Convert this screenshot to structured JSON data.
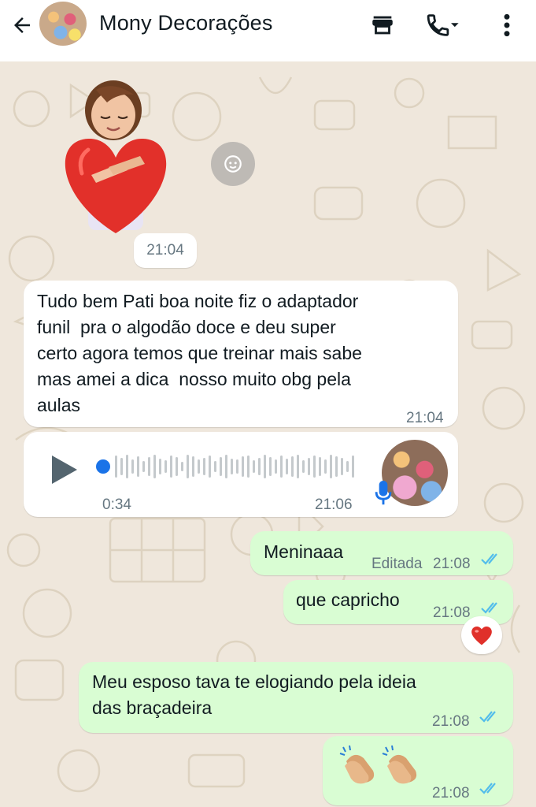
{
  "header": {
    "contact_name": "Mony Decorações",
    "icons": [
      "back-arrow-icon",
      "store-icon",
      "phone-call-icon",
      "more-vert-icon"
    ]
  },
  "messages": [
    {
      "type": "sticker",
      "direction": "incoming",
      "time": "21:04"
    },
    {
      "type": "text",
      "direction": "incoming",
      "lines": [
        "Tudo bem Pati boa noite fiz o adaptador",
        "funil  pra o algodão doce e deu super",
        "certo agora temos que treinar mais sabe",
        "mas amei a dica  nosso muito obg pela",
        "aulas"
      ],
      "time": "21:04"
    },
    {
      "type": "audio",
      "direction": "incoming",
      "duration": "0:34",
      "time": "21:06",
      "progress": 0.0
    },
    {
      "type": "text",
      "direction": "outgoing",
      "text": "Meninaaa",
      "edited_label": "Editada",
      "time": "21:08"
    },
    {
      "type": "text",
      "direction": "outgoing",
      "text": "que capricho",
      "time": "21:08",
      "reaction": "red-heart-emoji"
    },
    {
      "type": "text",
      "direction": "outgoing",
      "lines": [
        "Meu esposo tava te elogiando pela ideia",
        "das braçadeira"
      ],
      "time": "21:08"
    },
    {
      "type": "emoji",
      "direction": "outgoing",
      "emoji": [
        "clapping-hands-emoji",
        "clapping-hands-emoji"
      ],
      "time": "21:08"
    }
  ],
  "colors": {
    "incoming_bubble": "#ffffff",
    "outgoing_bubble": "#d9fdd3",
    "read_ticks": "#53bdeb",
    "audio_accent": "#1a73e8",
    "wallpaper": "#efe7dc"
  }
}
